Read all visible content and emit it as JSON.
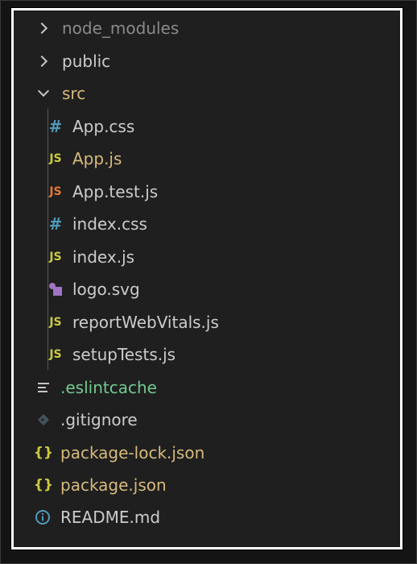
{
  "explorer": {
    "items": [
      {
        "label": "node_modules",
        "icon": "chevron-right-icon",
        "color": "#8a8a8a"
      },
      {
        "label": "public",
        "icon": "chevron-right-icon",
        "color": "#cccccc"
      },
      {
        "label": "src",
        "icon": "chevron-down-icon",
        "color": "#d7ba7d"
      },
      {
        "label": "App.css",
        "icon": "css-hash-icon",
        "icon_text": "#",
        "color": "#cccccc"
      },
      {
        "label": "App.js",
        "icon": "js-icon",
        "icon_text": "JS",
        "color": "#d7ba7d"
      },
      {
        "label": "App.test.js",
        "icon": "js-test-icon",
        "icon_text": "JS",
        "color": "#cccccc"
      },
      {
        "label": "index.css",
        "icon": "css-hash-icon",
        "icon_text": "#",
        "color": "#cccccc"
      },
      {
        "label": "index.js",
        "icon": "js-icon",
        "icon_text": "JS",
        "color": "#cccccc"
      },
      {
        "label": "logo.svg",
        "icon": "svg-shapes-icon",
        "color": "#cccccc"
      },
      {
        "label": "reportWebVitals.js",
        "icon": "js-icon",
        "icon_text": "JS",
        "color": "#cccccc"
      },
      {
        "label": "setupTests.js",
        "icon": "js-icon",
        "icon_text": "JS",
        "color": "#cccccc"
      },
      {
        "label": ".eslintcache",
        "icon": "lines-icon",
        "color": "#73c991"
      },
      {
        "label": ".gitignore",
        "icon": "git-diamond-icon",
        "color": "#cccccc"
      },
      {
        "label": "package-lock.json",
        "icon": "json-braces-icon",
        "icon_text": "{}",
        "color": "#d7ba7d"
      },
      {
        "label": "package.json",
        "icon": "json-braces-icon",
        "icon_text": "{}",
        "color": "#d7ba7d"
      },
      {
        "label": "README.md",
        "icon": "info-icon",
        "color": "#cccccc"
      }
    ]
  }
}
